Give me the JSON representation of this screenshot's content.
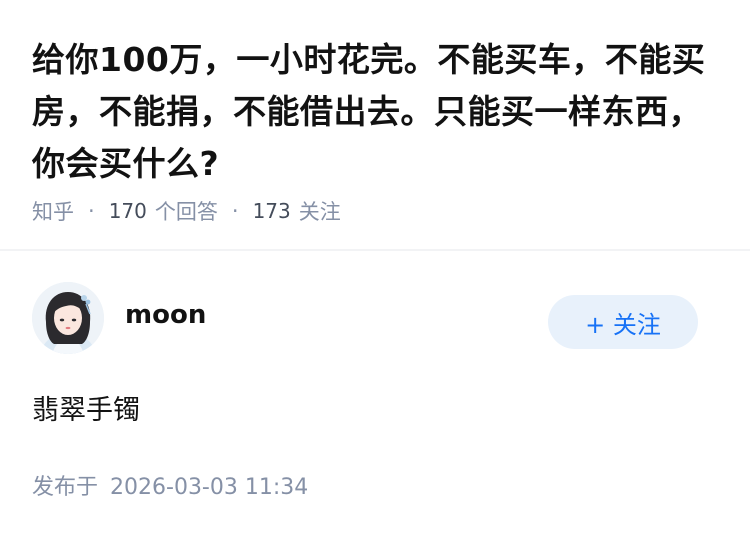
{
  "question": {
    "title": "给你100万，一小时花完。不能买车，不能买房，不能捐，不能借出去。只能买一样东西，你会买什么?",
    "source": "知乎",
    "answer_count": "170",
    "answer_unit": "个回答",
    "follower_count": "173",
    "follower_unit": "关注"
  },
  "answer": {
    "author_name": "moon",
    "follow_button_label": "+ 关注",
    "content": "翡翠手镯",
    "published_label": "发布于",
    "published_time": "2026-03-03 11:34"
  },
  "colors": {
    "meta_gray": "#8590a6",
    "accent_blue": "#1772f6",
    "follow_bg": "#e8f1fb"
  }
}
